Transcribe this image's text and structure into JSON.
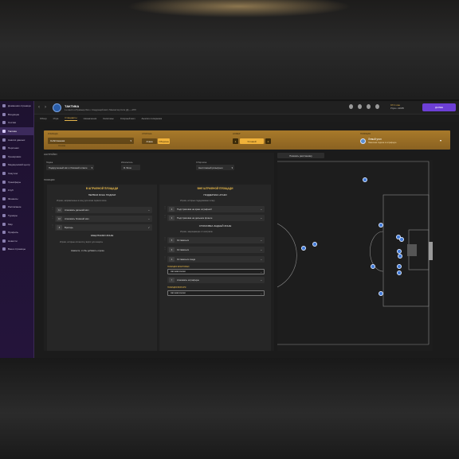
{
  "sidebar": {
    "items": [
      {
        "label": "Домашняя страница",
        "active": false
      },
      {
        "label": "Входящие",
        "active": false
      },
      {
        "label": "Состав",
        "active": false
      },
      {
        "label": "Тактика",
        "active": true
      },
      {
        "label": "Анализ данных",
        "active": false
      },
      {
        "label": "Персонал",
        "active": false
      },
      {
        "label": "Тренировки",
        "active": false
      },
      {
        "label": "Медицинский центр",
        "active": false
      },
      {
        "label": "Скаутинг",
        "active": false
      },
      {
        "label": "Трансферы",
        "active": false
      },
      {
        "label": "Клуб",
        "active": false
      },
      {
        "label": "Финансы",
        "active": false
      },
      {
        "label": "Расписание",
        "active": false
      },
      {
        "label": "Турниры",
        "active": false
      },
      {
        "label": "Мир",
        "active": false
      },
      {
        "label": "Профиль",
        "active": false
      },
      {
        "label": "Новости",
        "active": false
      },
      {
        "label": "Ваши страницы",
        "active": false
      }
    ]
  },
  "header": {
    "title": "ТАКТИКА",
    "subtitle": "1-е место в Премьер-Лиге • Следующий матч: Манчестер Сити (Д) — АПЛ",
    "date_line1": "Сб 1 сен",
    "date_line2": "Утро • 13:05",
    "continue_label": "ДАЛЕЕ"
  },
  "tabs": [
    {
      "label": "Обзор",
      "active": false
    },
    {
      "label": "Игра",
      "active": false
    },
    {
      "label": "Стандарты",
      "active": true
    },
    {
      "label": "Назначения",
      "active": false
    },
    {
      "label": "Капитаны",
      "active": false
    },
    {
      "label": "Спорный мяч",
      "active": false
    },
    {
      "label": "Анализ соперника",
      "active": false
    }
  ],
  "gold_band": {
    "team_label": "КОМАНДА",
    "team_value": "Собственная",
    "team_sub": "Основа",
    "side_label": "СТОРОНА",
    "side_attack": "Атака",
    "side_defend": "Оборона",
    "count_label": "НОМЕР",
    "count_value": "1",
    "count_name": "Угловой",
    "count_next": "2",
    "position_label": "ПОЗИЦИЯ",
    "position_value": "Левый угол",
    "position_sub": "Навесная подача в штрафную"
  },
  "settings": {
    "section_label": "НАСТРОЙКИ",
    "field1_label": "Подача",
    "field1_value": "Подкрученный мяч к ближней штанге",
    "field2_label": "Исполнитель",
    "field2_value": "Я. Блок",
    "field3_label": "Отбор мяча",
    "field3_value": "Неотложный розыгрыш"
  },
  "roles_label": "ПОЗИЦИИ",
  "left_column": {
    "title": "В ШТРАФНОЙ ПЛОЩАДИ",
    "sub_title": "ПЕРВАЯ ЗОНА ПОДАЧИ",
    "note": "Игроки, направленные в зону для атаки первого мяча",
    "rows": [
      {
        "num": "11",
        "text": "Атаковать дальний мяч"
      },
      {
        "num": "10",
        "text": "Атаковать ближний мяч"
      },
      {
        "num": "8",
        "text": "Вратарь"
      }
    ],
    "section2_title": "ЗАЩИТНИКИ ЗОНЫ",
    "section2_note": "Игроки, которые остаются у ворот для защиты",
    "section2_link": "Нажмите, чтобы добавить игрока"
  },
  "right_column": {
    "title": "ВНЕ ШТРАФНОЙ ПЛОЩАДИ",
    "sub_title": "ПОДДЕРЖКА АТАКИ",
    "note": "Игроки, которые поддерживают атаку",
    "rows": [
      {
        "num": "2",
        "text": "Подстраховка на краю штрафной"
      },
      {
        "num": "3",
        "text": "Подстраховка на дальнем фланге"
      }
    ],
    "section2_title": "СТРАХОВКА ЗАДНЕЙ ЗОНЫ",
    "section2_note": "Игроки, защищающие от контратак",
    "rows2": [
      {
        "num": "5",
        "text": "Оставаться"
      },
      {
        "num": "6",
        "text": "Оставаться"
      },
      {
        "num": "4",
        "text": "Оставаться сзади"
      }
    ],
    "mini1_label": "ПОЗИЦИЯ ФЛАНГОВЫХ",
    "dropdown1": "Автоматически",
    "row_extra": {
      "num": "7",
      "text": "Атаковать штрафную"
    },
    "mini2_label": "ПОЗИЦИЯ ВРАТАРЯ",
    "dropdown2": "Автоматически"
  },
  "pitch": {
    "view_button": "Показать расстановку",
    "player_color": "#3f79d8",
    "line_color": "#8a8a8a"
  },
  "colors": {
    "accent_gold": "#e4b44b",
    "accent_purple": "#6d3fd6",
    "band_gold": "#a87a2a"
  }
}
